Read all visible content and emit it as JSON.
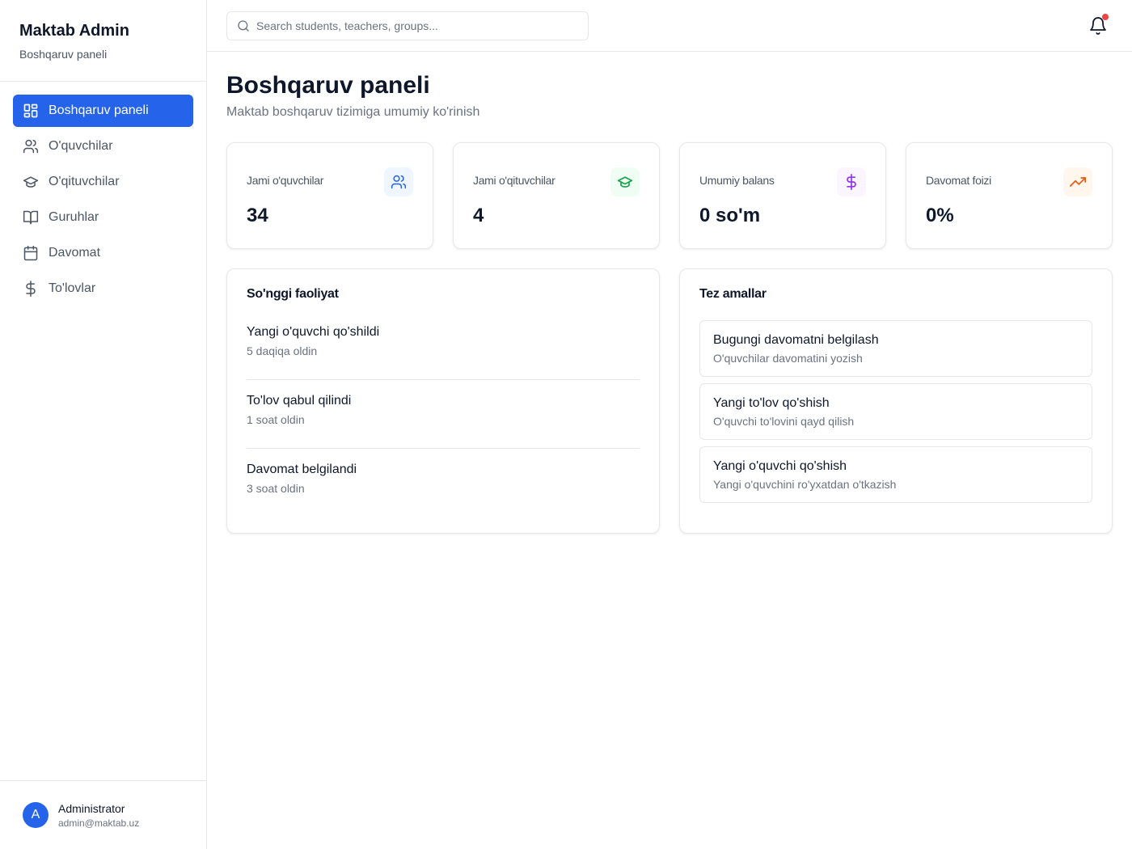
{
  "brand": {
    "title": "Maktab Admin",
    "subtitle": "Boshqaruv paneli"
  },
  "nav": [
    {
      "label": "Boshqaruv paneli",
      "icon": "dashboard-icon",
      "active": true
    },
    {
      "label": "O'quvchilar",
      "icon": "users-icon"
    },
    {
      "label": "O'qituvchilar",
      "icon": "graduation-cap-icon"
    },
    {
      "label": "Guruhlar",
      "icon": "book-open-icon"
    },
    {
      "label": "Davomat",
      "icon": "calendar-icon"
    },
    {
      "label": "To'lovlar",
      "icon": "dollar-icon"
    }
  ],
  "user": {
    "initial": "A",
    "name": "Administrator",
    "email": "admin@maktab.uz"
  },
  "search": {
    "placeholder": "Search students, teachers, groups...",
    "value": ""
  },
  "notifications": {
    "has_unread": true
  },
  "page": {
    "title": "Boshqaruv paneli",
    "subtitle": "Maktab boshqaruv tizimiga umumiy ko'rinish"
  },
  "stats": [
    {
      "label": "Jami o'quvchilar",
      "value": "34",
      "icon": "users-icon",
      "color": "#2563eb",
      "bg": "#eff6ff"
    },
    {
      "label": "Jami o'qituvchilar",
      "value": "4",
      "icon": "graduation-cap-icon",
      "color": "#16a34a",
      "bg": "#f0fdf4"
    },
    {
      "label": "Umumiy balans",
      "value": "0 so'm",
      "icon": "dollar-icon",
      "color": "#9333ea",
      "bg": "#faf5ff"
    },
    {
      "label": "Davomat foizi",
      "value": "0%",
      "icon": "trending-up-icon",
      "color": "#ea580c",
      "bg": "#fff7ed"
    }
  ],
  "recent_activity": {
    "title": "So'nggi faoliyat",
    "items": [
      {
        "title": "Yangi o'quvchi qo'shildi",
        "time": "5 daqiqa oldin"
      },
      {
        "title": "To'lov qabul qilindi",
        "time": "1 soat oldin"
      },
      {
        "title": "Davomat belgilandi",
        "time": "3 soat oldin"
      }
    ]
  },
  "quick_actions": {
    "title": "Tez amallar",
    "items": [
      {
        "title": "Bugungi davomatni belgilash",
        "desc": "O'quvchilar davomatini yozish"
      },
      {
        "title": "Yangi to'lov qo'shish",
        "desc": "O'quvchi to'lovini qayd qilish"
      },
      {
        "title": "Yangi o'quvchi qo'shish",
        "desc": "Yangi o'quvchini ro'yxatdan o'tkazish"
      }
    ]
  }
}
